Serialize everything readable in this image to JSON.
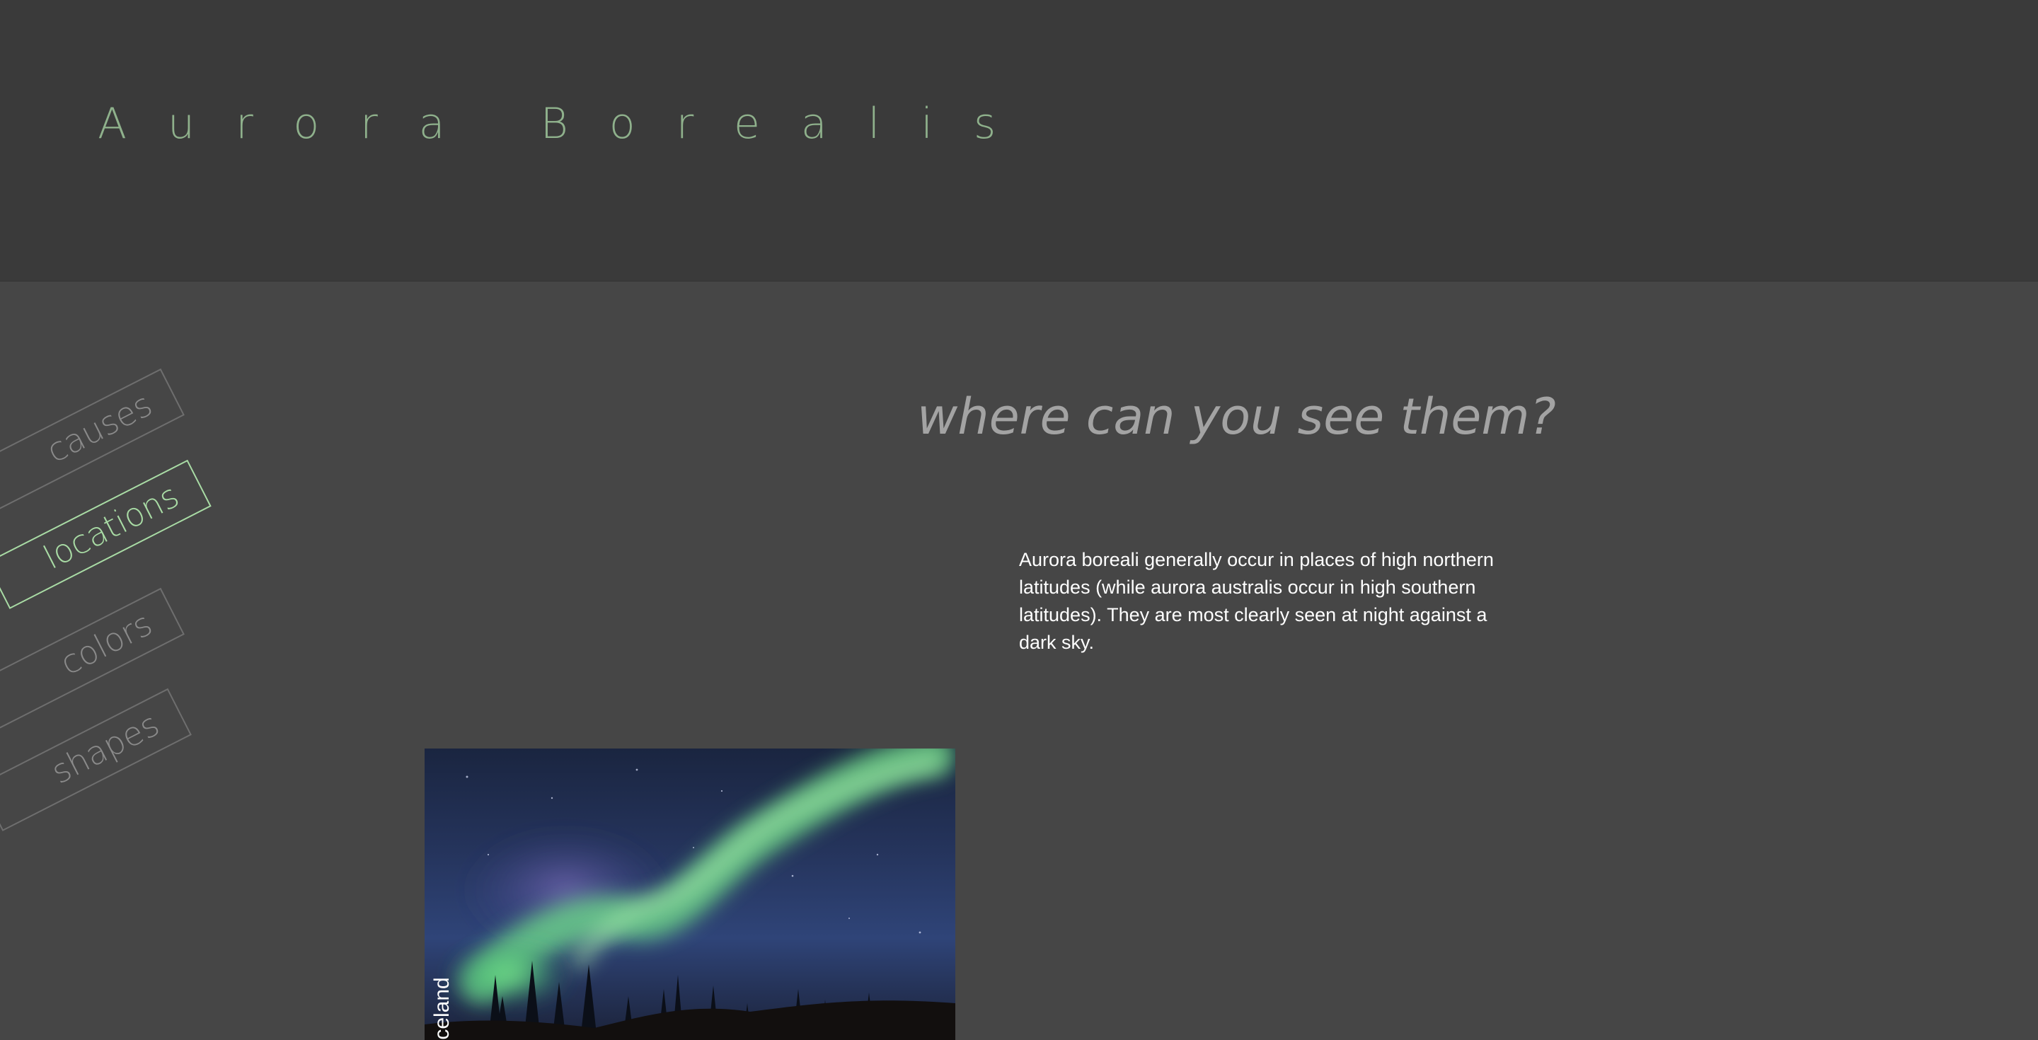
{
  "header": {
    "title": "Aurora Borealis"
  },
  "nav": {
    "tabs": [
      {
        "label": "causes",
        "active": false
      },
      {
        "label": "locations",
        "active": true
      },
      {
        "label": "colors",
        "active": false
      },
      {
        "label": "shapes",
        "active": false
      }
    ]
  },
  "main": {
    "heading": "where can you see them?",
    "body": "Aurora boreali generally occur in places of high northern latitudes (while aurora australis occur in high southern latitudes). They are most clearly seen at night against a dark sky.",
    "photo": {
      "caption": "Iceland",
      "icon": "aurora-photo"
    }
  },
  "colors": {
    "header_bg": "#3a3a3a",
    "page_bg": "#464646",
    "accent_green": "#a9dca5",
    "title_green": "#8fb18c",
    "muted_text": "#8a8a8a"
  }
}
